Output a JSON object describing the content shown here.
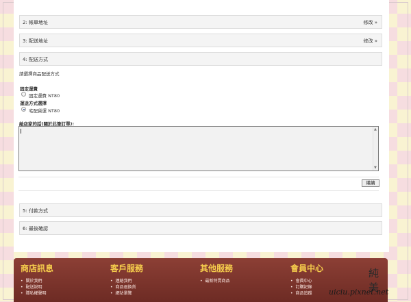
{
  "sections": {
    "billing": {
      "title": "2: 帳單地址",
      "edit": "修改 »"
    },
    "shipping": {
      "title": "3: 配送地址",
      "edit": "修改 »"
    },
    "delivery": {
      "title": "4: 配送方式"
    },
    "payment": {
      "title": "5: 付款方式"
    },
    "confirm": {
      "title": "6: 最後確認"
    }
  },
  "delivery": {
    "instruction": "請選擇商品配送方式",
    "group1_label": "固定運費",
    "option1": "固定運費 NT80",
    "group2_label": "運送方式選擇",
    "option2": "宅配貨運 NT80",
    "selected": "option2"
  },
  "comment": {
    "label": "給店家的話(關於此筆訂單):",
    "value": ""
  },
  "continue_label": "繼續",
  "footer": {
    "columns": [
      {
        "title": "商店訊息",
        "items": [
          "關於我們",
          "配送說明",
          "隱私權聲明"
        ]
      },
      {
        "title": "客戶服務",
        "items": [
          "連絡我們",
          "商品退換貨",
          "網站瀏覽"
        ]
      },
      {
        "title": "其他服務",
        "items": [
          "最新特賣商品"
        ]
      },
      {
        "title": "會員中心",
        "items": [
          "會員中心",
          "訂購記錄",
          "商品追蹤"
        ]
      }
    ]
  },
  "watermark": {
    "name": "純 美",
    "url": "uiciu.pixnet.net"
  }
}
